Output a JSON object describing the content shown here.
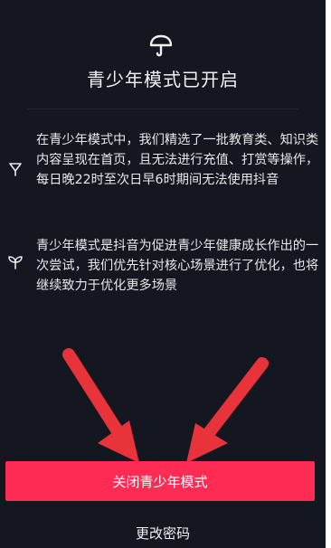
{
  "header": {
    "icon": "umbrella-icon",
    "title": "青少年模式已开启"
  },
  "info": [
    {
      "icon": "cup-icon",
      "text": "在青少年模式中，我们精选了一批教育类、知识类内容呈现在首页，且无法进行充值、打赏等操作，每日晚22时至次日早6时期间无法使用抖音"
    },
    {
      "icon": "sprout-icon",
      "text": "青少年模式是抖音为促进青少年健康成长作出的一次尝试，我们优先针对核心场景进行了优化，也将继续致力于优化更多场景"
    }
  ],
  "actions": {
    "close_button": "关闭青少年模式",
    "change_password": "更改密码"
  },
  "colors": {
    "background": "#141720",
    "accent": "#fe2c55",
    "annotation_arrow": "#e8333b"
  }
}
